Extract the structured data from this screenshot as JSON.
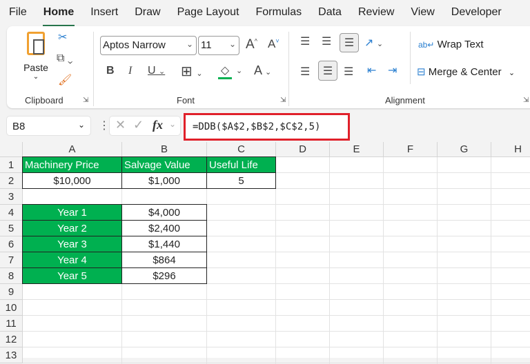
{
  "menu": [
    "File",
    "Home",
    "Insert",
    "Draw",
    "Page Layout",
    "Formulas",
    "Data",
    "Review",
    "View",
    "Developer"
  ],
  "ribbon": {
    "paste": "Paste",
    "clipboard": "Clipboard",
    "font_name": "Aptos Narrow",
    "font_size": "11",
    "font": "Font",
    "alignment": "Alignment",
    "wrap_text": "Wrap Text",
    "merge_center": "Merge & Center"
  },
  "formula_bar": {
    "name_box": "B8",
    "fx": "fx",
    "formula": "=DDB($A$2,$B$2,$C$2,5)"
  },
  "columns": [
    "A",
    "B",
    "C",
    "D",
    "E",
    "F",
    "G",
    "H"
  ],
  "rows": [
    "1",
    "2",
    "3",
    "4",
    "5",
    "6",
    "7",
    "8",
    "9",
    "10",
    "11",
    "12",
    "13"
  ],
  "cells": {
    "A1": "Machinery Price",
    "B1": "Salvage Value",
    "C1": "Useful Life",
    "A2": "$10,000",
    "B2": "$1,000",
    "C2": "5",
    "A4": "Year 1",
    "B4": "$4,000",
    "A5": "Year 2",
    "B5": "$2,400",
    "A6": "Year 3",
    "B6": "$1,440",
    "A7": "Year 4",
    "B7": "$864",
    "A8": "Year 5",
    "B8": "$296"
  },
  "colors": {
    "header_fill": "#00b050",
    "highlight": "#e0202a"
  }
}
